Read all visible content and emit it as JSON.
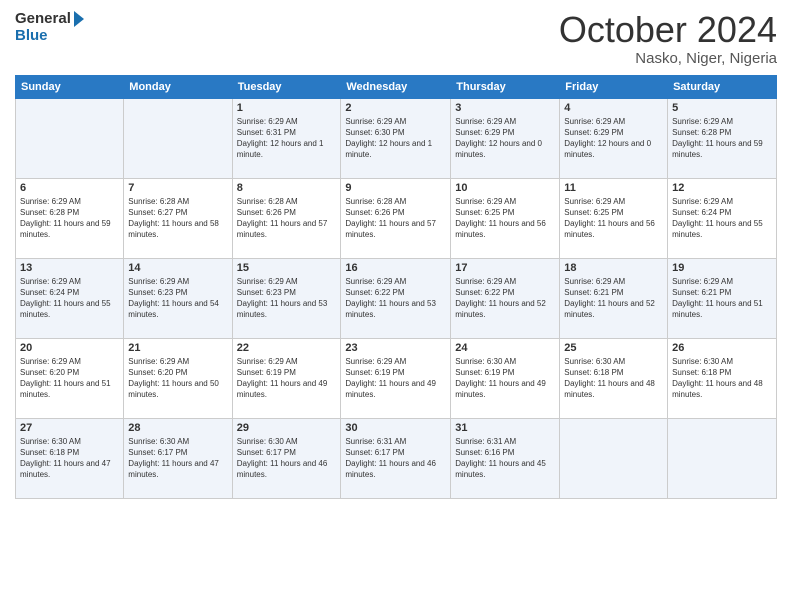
{
  "header": {
    "logo_general": "General",
    "logo_blue": "Blue",
    "month": "October 2024",
    "location": "Nasko, Niger, Nigeria"
  },
  "weekdays": [
    "Sunday",
    "Monday",
    "Tuesday",
    "Wednesday",
    "Thursday",
    "Friday",
    "Saturday"
  ],
  "weeks": [
    [
      null,
      null,
      {
        "day": "1",
        "sunrise": "6:29 AM",
        "sunset": "6:31 PM",
        "daylight": "12 hours and 1 minute."
      },
      {
        "day": "2",
        "sunrise": "6:29 AM",
        "sunset": "6:30 PM",
        "daylight": "12 hours and 1 minute."
      },
      {
        "day": "3",
        "sunrise": "6:29 AM",
        "sunset": "6:29 PM",
        "daylight": "12 hours and 0 minutes."
      },
      {
        "day": "4",
        "sunrise": "6:29 AM",
        "sunset": "6:29 PM",
        "daylight": "12 hours and 0 minutes."
      },
      {
        "day": "5",
        "sunrise": "6:29 AM",
        "sunset": "6:28 PM",
        "daylight": "11 hours and 59 minutes."
      }
    ],
    [
      {
        "day": "6",
        "sunrise": "6:29 AM",
        "sunset": "6:28 PM",
        "daylight": "11 hours and 59 minutes."
      },
      {
        "day": "7",
        "sunrise": "6:28 AM",
        "sunset": "6:27 PM",
        "daylight": "11 hours and 58 minutes."
      },
      {
        "day": "8",
        "sunrise": "6:28 AM",
        "sunset": "6:26 PM",
        "daylight": "11 hours and 57 minutes."
      },
      {
        "day": "9",
        "sunrise": "6:28 AM",
        "sunset": "6:26 PM",
        "daylight": "11 hours and 57 minutes."
      },
      {
        "day": "10",
        "sunrise": "6:29 AM",
        "sunset": "6:25 PM",
        "daylight": "11 hours and 56 minutes."
      },
      {
        "day": "11",
        "sunrise": "6:29 AM",
        "sunset": "6:25 PM",
        "daylight": "11 hours and 56 minutes."
      },
      {
        "day": "12",
        "sunrise": "6:29 AM",
        "sunset": "6:24 PM",
        "daylight": "11 hours and 55 minutes."
      }
    ],
    [
      {
        "day": "13",
        "sunrise": "6:29 AM",
        "sunset": "6:24 PM",
        "daylight": "11 hours and 55 minutes."
      },
      {
        "day": "14",
        "sunrise": "6:29 AM",
        "sunset": "6:23 PM",
        "daylight": "11 hours and 54 minutes."
      },
      {
        "day": "15",
        "sunrise": "6:29 AM",
        "sunset": "6:23 PM",
        "daylight": "11 hours and 53 minutes."
      },
      {
        "day": "16",
        "sunrise": "6:29 AM",
        "sunset": "6:22 PM",
        "daylight": "11 hours and 53 minutes."
      },
      {
        "day": "17",
        "sunrise": "6:29 AM",
        "sunset": "6:22 PM",
        "daylight": "11 hours and 52 minutes."
      },
      {
        "day": "18",
        "sunrise": "6:29 AM",
        "sunset": "6:21 PM",
        "daylight": "11 hours and 52 minutes."
      },
      {
        "day": "19",
        "sunrise": "6:29 AM",
        "sunset": "6:21 PM",
        "daylight": "11 hours and 51 minutes."
      }
    ],
    [
      {
        "day": "20",
        "sunrise": "6:29 AM",
        "sunset": "6:20 PM",
        "daylight": "11 hours and 51 minutes."
      },
      {
        "day": "21",
        "sunrise": "6:29 AM",
        "sunset": "6:20 PM",
        "daylight": "11 hours and 50 minutes."
      },
      {
        "day": "22",
        "sunrise": "6:29 AM",
        "sunset": "6:19 PM",
        "daylight": "11 hours and 49 minutes."
      },
      {
        "day": "23",
        "sunrise": "6:29 AM",
        "sunset": "6:19 PM",
        "daylight": "11 hours and 49 minutes."
      },
      {
        "day": "24",
        "sunrise": "6:30 AM",
        "sunset": "6:19 PM",
        "daylight": "11 hours and 49 minutes."
      },
      {
        "day": "25",
        "sunrise": "6:30 AM",
        "sunset": "6:18 PM",
        "daylight": "11 hours and 48 minutes."
      },
      {
        "day": "26",
        "sunrise": "6:30 AM",
        "sunset": "6:18 PM",
        "daylight": "11 hours and 48 minutes."
      }
    ],
    [
      {
        "day": "27",
        "sunrise": "6:30 AM",
        "sunset": "6:18 PM",
        "daylight": "11 hours and 47 minutes."
      },
      {
        "day": "28",
        "sunrise": "6:30 AM",
        "sunset": "6:17 PM",
        "daylight": "11 hours and 47 minutes."
      },
      {
        "day": "29",
        "sunrise": "6:30 AM",
        "sunset": "6:17 PM",
        "daylight": "11 hours and 46 minutes."
      },
      {
        "day": "30",
        "sunrise": "6:31 AM",
        "sunset": "6:17 PM",
        "daylight": "11 hours and 46 minutes."
      },
      {
        "day": "31",
        "sunrise": "6:31 AM",
        "sunset": "6:16 PM",
        "daylight": "11 hours and 45 minutes."
      },
      null,
      null
    ]
  ]
}
